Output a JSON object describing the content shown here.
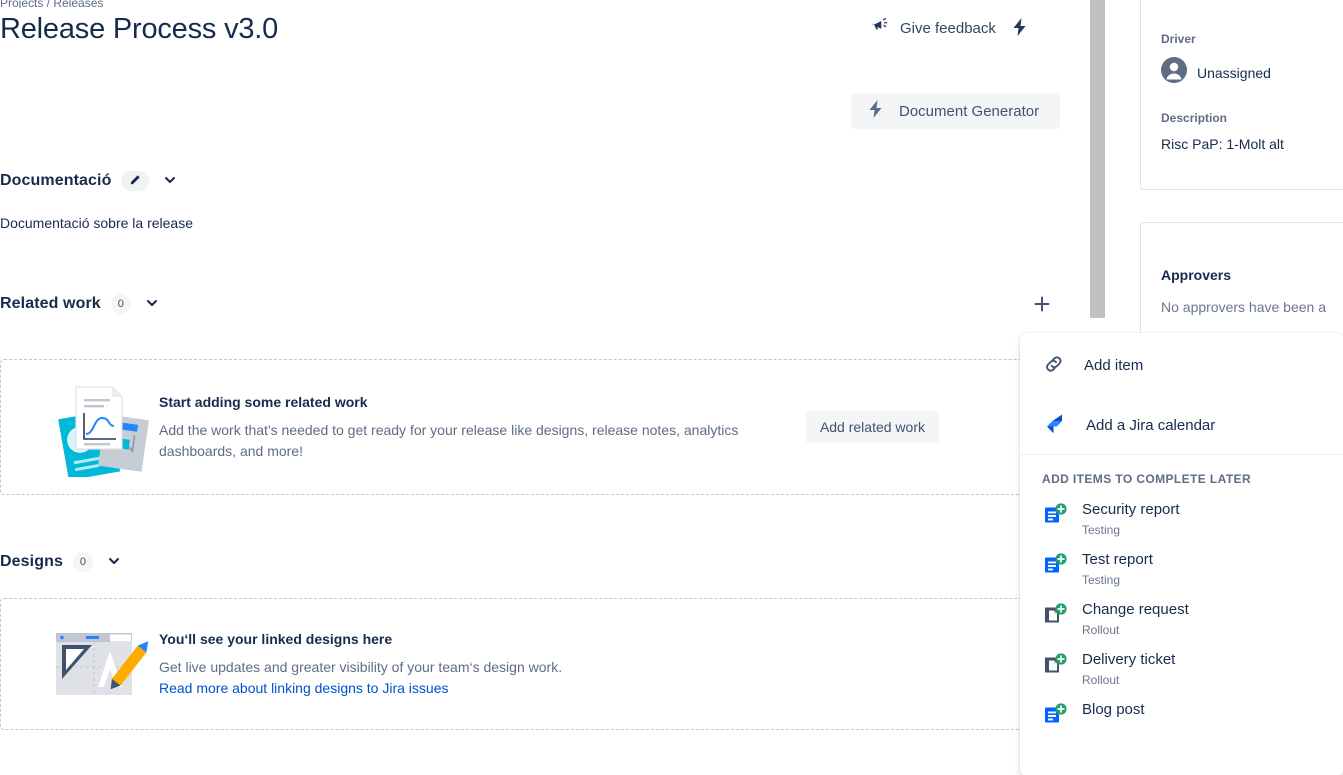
{
  "breadcrumb": "Projects / Releases",
  "header": {
    "title": "Release Process v3.0",
    "feedback_label": "Give feedback",
    "feedback_icon": "megaphone-icon",
    "bolt_icon": "lightning-bolt-icon",
    "doc_generator_label": "Document Generator",
    "doc_generator_icon": "lightning-bolt-icon"
  },
  "documentation": {
    "title": "Documentació",
    "edit_icon": "pencil-icon",
    "chevron_icon": "chevron-down-icon",
    "body": "Documentació sobre la release"
  },
  "related_work": {
    "title": "Related work",
    "count": "0",
    "chevron_icon": "chevron-down-icon",
    "add_icon": "plus-icon",
    "empty_title": "Start adding some related work",
    "empty_desc": "Add the work that's needed to get ready for your release like designs, release notes, analytics dashboards, and more!",
    "cta_label": "Add related work",
    "illustration": "documents-illustration"
  },
  "designs": {
    "title": "Designs",
    "count": "0",
    "chevron_icon": "chevron-down-icon",
    "empty_title": "You‘ll see your linked designs here",
    "empty_desc": "Get live updates and greater visibility of your team‘s design work.",
    "empty_link": "Read more about linking designs to Jira issues",
    "illustration": "design-canvas-illustration"
  },
  "sidebar": {
    "driver_label": "Driver",
    "driver_value": "Unassigned",
    "driver_avatar_icon": "person-avatar-icon",
    "description_label": "Description",
    "description_value": "Risc PaP: 1-Molt alt",
    "approvers_heading": "Approvers",
    "approvers_empty": "No approvers have been a"
  },
  "menu": {
    "items": [
      {
        "label": "Add item",
        "icon": "link-chain-icon"
      },
      {
        "label": "Add a Jira calendar",
        "icon": "jira-logo-icon"
      }
    ],
    "section_title": "ADD ITEMS TO COMPLETE LATER",
    "options": [
      {
        "name": "Security report",
        "sub": "Testing",
        "icon": "document-add-blue-icon"
      },
      {
        "name": "Test report",
        "sub": "Testing",
        "icon": "document-add-blue-icon"
      },
      {
        "name": "Change request",
        "sub": "Rollout",
        "icon": "document-add-slate-icon"
      },
      {
        "name": "Delivery ticket",
        "sub": "Rollout",
        "icon": "document-add-slate-icon"
      },
      {
        "name": "Blog post",
        "sub": "",
        "icon": "document-add-blue-icon"
      }
    ]
  },
  "colors": {
    "brand_blue": "#0052cc",
    "text_primary": "#172b4d",
    "text_subtle": "#5e6c84",
    "green_badge": "#22a06b",
    "neutral_bg": "#f4f5f7"
  }
}
